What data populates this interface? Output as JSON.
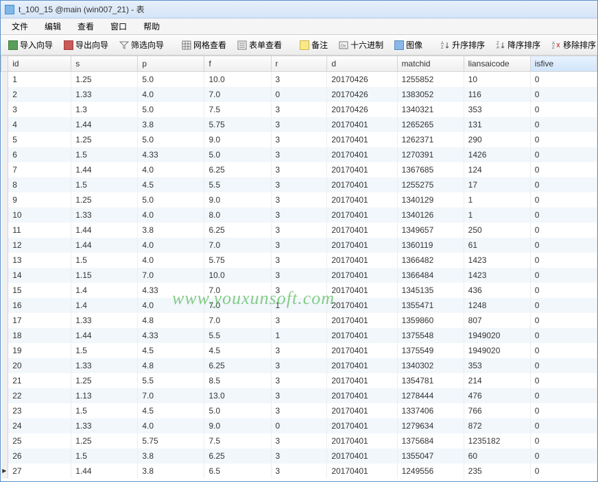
{
  "titlebar": {
    "text": "t_100_15 @main (win007_21) - 表"
  },
  "menu": {
    "file": "文件",
    "edit": "编辑",
    "view": "查看",
    "window": "窗口",
    "help": "帮助"
  },
  "toolbar": {
    "import": "导入向导",
    "export": "导出向导",
    "filter": "筛选向导",
    "grid": "网格查看",
    "form": "表单查看",
    "note": "备注",
    "hex": "十六进制",
    "image": "图像",
    "asc": "升序排序",
    "desc": "降序排序",
    "remove_sort": "移除排序"
  },
  "columns": [
    "id",
    "s",
    "p",
    "f",
    "r",
    "d",
    "matchid",
    "liansaicode",
    "isfive"
  ],
  "sorted_column": "isfive",
  "watermark": "www.youxunsoft.com",
  "chart_data": {
    "type": "table",
    "columns": [
      "id",
      "s",
      "p",
      "f",
      "r",
      "d",
      "matchid",
      "liansaicode",
      "isfive"
    ],
    "rows": [
      [
        1,
        1.25,
        5.0,
        10.0,
        3,
        20170426,
        1255852,
        10,
        0
      ],
      [
        2,
        1.33,
        4.0,
        7.0,
        0,
        20170426,
        1383052,
        116,
        0
      ],
      [
        3,
        1.3,
        5.0,
        7.5,
        3,
        20170426,
        1340321,
        353,
        0
      ],
      [
        4,
        1.44,
        3.8,
        5.75,
        3,
        20170401,
        1265265,
        131,
        0
      ],
      [
        5,
        1.25,
        5.0,
        9.0,
        3,
        20170401,
        1262371,
        290,
        0
      ],
      [
        6,
        1.5,
        4.33,
        5.0,
        3,
        20170401,
        1270391,
        1426,
        0
      ],
      [
        7,
        1.44,
        4.0,
        6.25,
        3,
        20170401,
        1367685,
        124,
        0
      ],
      [
        8,
        1.5,
        4.5,
        5.5,
        3,
        20170401,
        1255275,
        17,
        0
      ],
      [
        9,
        1.25,
        5.0,
        9.0,
        3,
        20170401,
        1340129,
        1,
        0
      ],
      [
        10,
        1.33,
        4.0,
        8.0,
        3,
        20170401,
        1340126,
        1,
        0
      ],
      [
        11,
        1.44,
        3.8,
        6.25,
        3,
        20170401,
        1349657,
        250,
        0
      ],
      [
        12,
        1.44,
        4.0,
        7.0,
        3,
        20170401,
        1360119,
        61,
        0
      ],
      [
        13,
        1.5,
        4.0,
        5.75,
        3,
        20170401,
        1366482,
        1423,
        0
      ],
      [
        14,
        1.15,
        7.0,
        10.0,
        3,
        20170401,
        1366484,
        1423,
        0
      ],
      [
        15,
        1.4,
        4.33,
        7.0,
        3,
        20170401,
        1345135,
        436,
        0
      ],
      [
        16,
        1.4,
        4.0,
        7.0,
        1,
        20170401,
        1355471,
        1248,
        0
      ],
      [
        17,
        1.33,
        4.8,
        7.0,
        3,
        20170401,
        1359860,
        807,
        0
      ],
      [
        18,
        1.44,
        4.33,
        5.5,
        1,
        20170401,
        1375548,
        1949020,
        0
      ],
      [
        19,
        1.5,
        4.5,
        4.5,
        3,
        20170401,
        1375549,
        1949020,
        0
      ],
      [
        20,
        1.33,
        4.8,
        6.25,
        3,
        20170401,
        1340302,
        353,
        0
      ],
      [
        21,
        1.25,
        5.5,
        8.5,
        3,
        20170401,
        1354781,
        214,
        0
      ],
      [
        22,
        1.13,
        7.0,
        13.0,
        3,
        20170401,
        1278444,
        476,
        0
      ],
      [
        23,
        1.5,
        4.5,
        5.0,
        3,
        20170401,
        1337406,
        766,
        0
      ],
      [
        24,
        1.33,
        4.0,
        9.0,
        0,
        20170401,
        1279634,
        872,
        0
      ],
      [
        25,
        1.25,
        5.75,
        7.5,
        3,
        20170401,
        1375684,
        1235182,
        0
      ],
      [
        26,
        1.5,
        3.8,
        6.25,
        3,
        20170401,
        1355047,
        60,
        0
      ],
      [
        27,
        1.44,
        3.8,
        6.5,
        3,
        20170401,
        1249556,
        235,
        0
      ]
    ]
  }
}
